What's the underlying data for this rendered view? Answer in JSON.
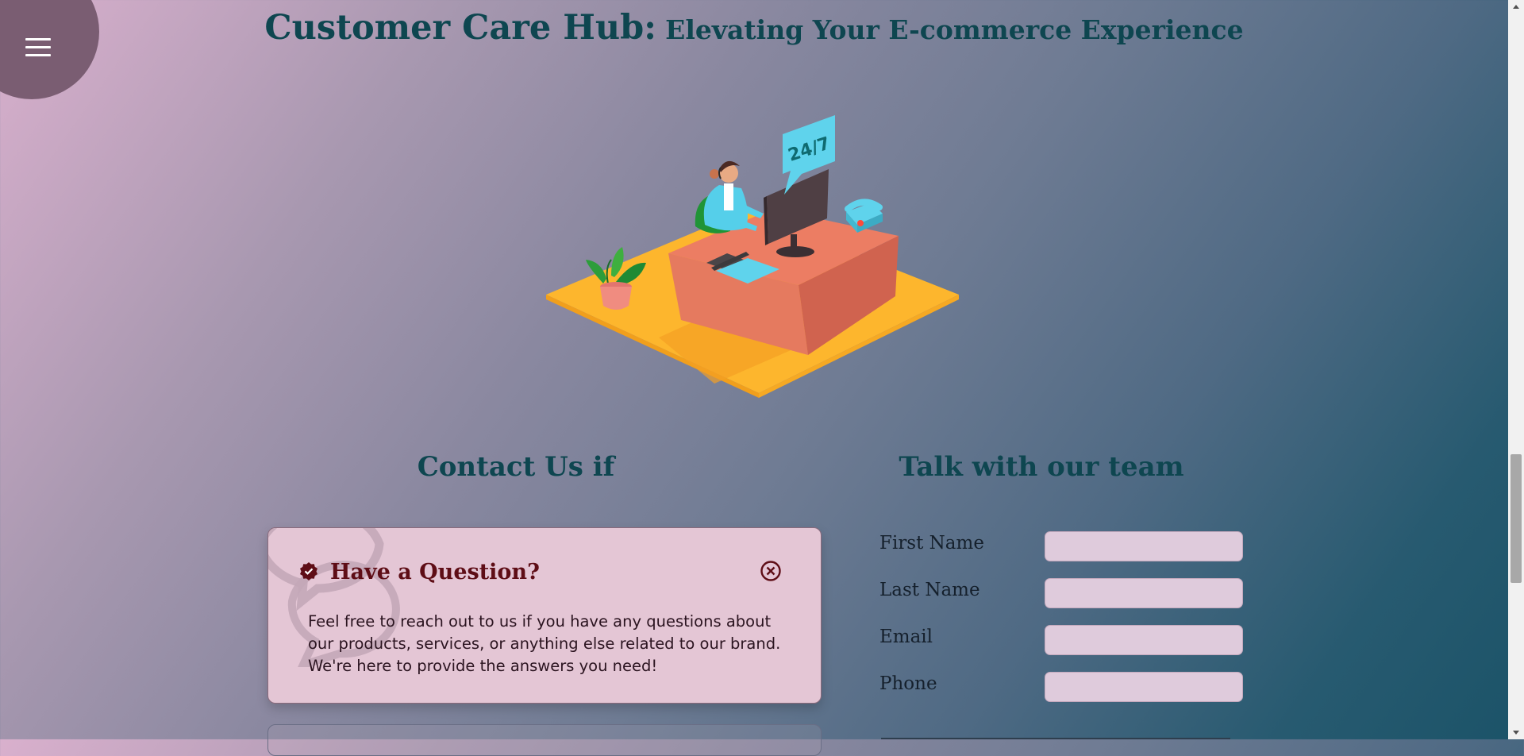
{
  "header": {
    "title_main": "Customer Care Hub:",
    "title_sub": "Elevating Your E-commerce Experience"
  },
  "menu": {
    "icon": "hamburger-icon"
  },
  "illustration": {
    "badge_text": "24/7"
  },
  "contact": {
    "heading": "Contact Us if",
    "card": {
      "title": "Have a Question?",
      "body": "Feel free to reach out to us if you have any questions about our products, services, or anything else related to our brand. We're here to provide the answers you need!"
    }
  },
  "team": {
    "heading": "Talk with our team",
    "fields": [
      {
        "label": "First Name",
        "value": ""
      },
      {
        "label": "Last Name",
        "value": ""
      },
      {
        "label": "Email",
        "value": ""
      },
      {
        "label": "Phone",
        "value": ""
      }
    ]
  },
  "colors": {
    "heading": "#0e4650",
    "card_bg": "#e4c6d5",
    "card_title": "#5e0d16",
    "menu_blob": "#7a5d72",
    "input_bg": "#dfcbdc"
  }
}
